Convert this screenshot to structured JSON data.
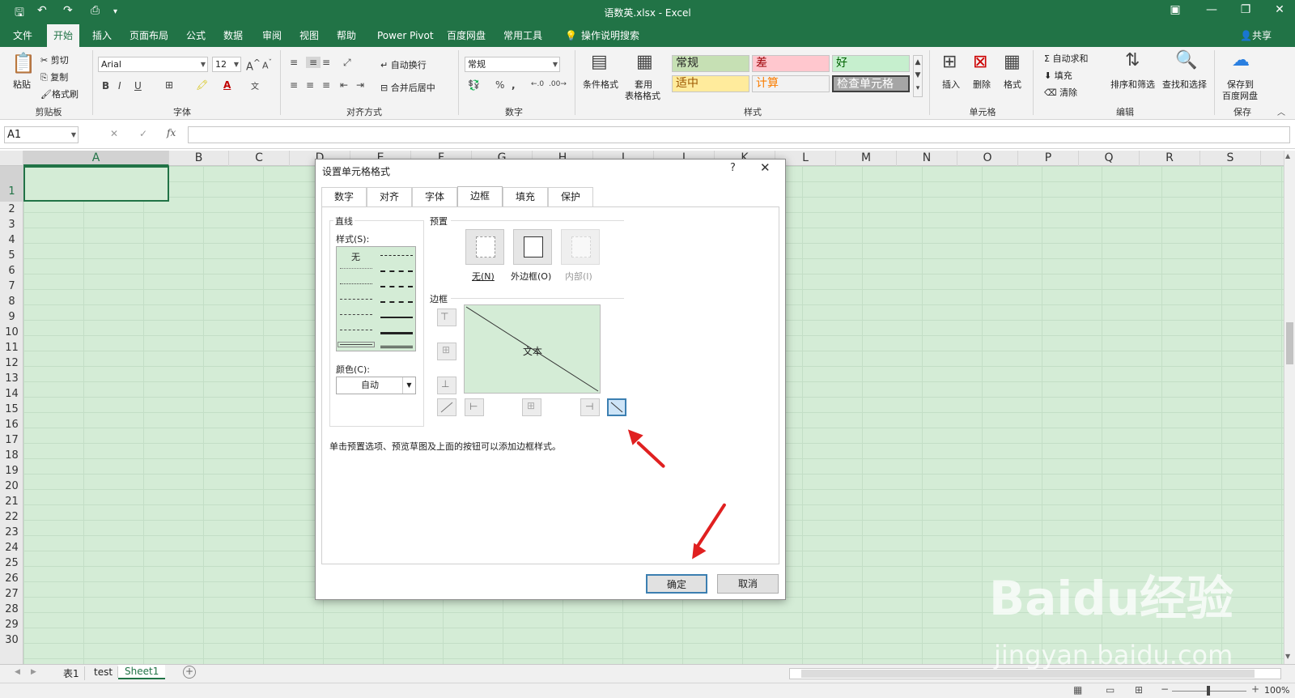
{
  "window": {
    "title": "语数英.xlsx  -  Excel"
  },
  "tabs": [
    "文件",
    "开始",
    "插入",
    "页面布局",
    "公式",
    "数据",
    "审阅",
    "视图",
    "帮助",
    "Power Pivot",
    "百度网盘",
    "常用工具",
    "操作说明搜索"
  ],
  "share": "共享",
  "ribbon": {
    "clipboard": {
      "paste": "粘贴",
      "cut": "剪切",
      "copy": "复制",
      "format_painter": "格式刷",
      "label": "剪贴板"
    },
    "font": {
      "name": "Arial",
      "size": "12",
      "label": "字体",
      "bold": "B",
      "italic": "I",
      "underline": "U"
    },
    "alignment": {
      "wrap": "自动换行",
      "merge": "合并后居中",
      "label": "对齐方式"
    },
    "number": {
      "format": "常规",
      "label": "数字",
      "percent": "%",
      "comma": ","
    },
    "styles": {
      "conditional": "条件格式",
      "table_line1": "套用",
      "table_line2": "表格格式",
      "normal": "常规",
      "bad": "差",
      "good": "好",
      "neutral": "适中",
      "calc": "计算",
      "check": "检查单元格",
      "label": "样式"
    },
    "cells": {
      "insert": "插入",
      "delete": "删除",
      "format": "格式",
      "label": "单元格"
    },
    "editing": {
      "autosum": "自动求和",
      "fill": "填充",
      "clear": "清除",
      "sort": "排序和筛选",
      "find": "查找和选择",
      "label": "编辑"
    },
    "save": {
      "line1": "保存到",
      "line2": "百度网盘",
      "label": "保存"
    }
  },
  "formula_bar": {
    "name_box": "A1",
    "fx": "fx",
    "cancel": "✕",
    "enter": "✓"
  },
  "columns": [
    "A",
    "B",
    "C",
    "D",
    "E",
    "F",
    "G",
    "H",
    "I",
    "J",
    "K",
    "L",
    "M",
    "N",
    "O",
    "P",
    "Q",
    "R",
    "S"
  ],
  "rows": [
    "1",
    "2",
    "3",
    "4",
    "5",
    "6",
    "7",
    "8",
    "9",
    "10",
    "11",
    "12",
    "13",
    "14",
    "15",
    "16",
    "17",
    "18",
    "19",
    "20",
    "21",
    "22",
    "23",
    "24",
    "25",
    "26",
    "27",
    "28",
    "29",
    "30"
  ],
  "sheets": [
    "表1",
    "test",
    "Sheet1"
  ],
  "active_sheet": "Sheet1",
  "status": {
    "zoom": "100%"
  },
  "dialog": {
    "title": "设置单元格格式",
    "help": "?",
    "tabs": [
      "数字",
      "对齐",
      "字体",
      "边框",
      "填充",
      "保护"
    ],
    "active_tab": "边框",
    "line_section": "直线",
    "style_label": "样式(S):",
    "style_none": "无",
    "color_label": "颜色(C):",
    "color_value": "自动",
    "presets_label": "预置",
    "preset_none": "无(N)",
    "preset_outline": "外边框(O)",
    "preset_inside": "内部(I)",
    "border_label": "边框",
    "preview_text": "文本",
    "hint": "单击预置选项、预览草图及上面的按钮可以添加边框样式。",
    "ok": "确定",
    "cancel": "取消"
  },
  "watermark": {
    "logo": "Baidu经验",
    "url": "jingyan.baidu.com"
  },
  "colors": {
    "excel_green": "#217346",
    "sheet_bg": "#d4ecd6",
    "arrow": "#e02020"
  }
}
